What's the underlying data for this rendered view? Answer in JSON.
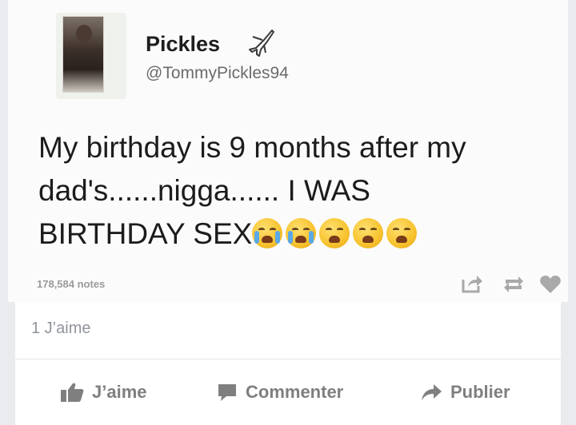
{
  "tweet": {
    "display_name": "Pickles",
    "name_icon": "airplane-icon",
    "handle": "@TommyPickles94",
    "text_line1": "My birthday is 9 months after my",
    "text_line2": "dad's......nigga...... I WAS",
    "text_line3": "BIRTHDAY SEX",
    "emojis": [
      "loudly-crying-face",
      "loudly-crying-face",
      "weary-face",
      "weary-face",
      "weary-face"
    ]
  },
  "tumblr": {
    "notes": "178,584 notes",
    "icons": [
      "share-icon",
      "reblog-icon",
      "heart-icon"
    ]
  },
  "facebook": {
    "like_count": "1 J’aime",
    "actions": {
      "like": "J’aime",
      "comment": "Commenter",
      "share": "Publier"
    },
    "colors": {
      "action_gray": "#7f7f7f",
      "meta_gray": "#90949c"
    }
  }
}
